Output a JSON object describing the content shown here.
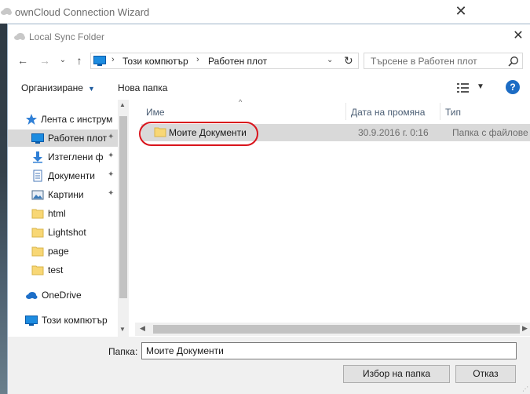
{
  "background_window": {
    "title": "ownCloud Connection Wizard",
    "close_glyph": "✕"
  },
  "dialog": {
    "title": "Local Sync Folder",
    "close_glyph": "✕"
  },
  "navigation": {
    "back_glyph": "←",
    "forward_glyph": "→",
    "recent_glyph": "⌄",
    "up_glyph": "↑",
    "address_crumbs": [
      "Този компютър",
      "Работен плот"
    ],
    "address_sep": "›",
    "dropdown_glyph": "⌄",
    "refresh_glyph": "↻",
    "search_placeholder": "Търсене в Работен плот"
  },
  "toolbar": {
    "organize_label": "Организиране",
    "organize_arrow": "▼",
    "new_folder_label": "Нова папка",
    "view_dropdown": "▼",
    "help_glyph": "?"
  },
  "nav_pane": {
    "items": [
      {
        "label": "Лента с инструм",
        "icon": "star-icon",
        "pinned": false,
        "selected": false
      },
      {
        "label": "Работен плот",
        "icon": "desktop-icon",
        "pinned": true,
        "selected": true
      },
      {
        "label": "Изтеглени ф",
        "icon": "download-icon",
        "pinned": true,
        "selected": false
      },
      {
        "label": "Документи",
        "icon": "documents-icon",
        "pinned": true,
        "selected": false
      },
      {
        "label": "Картини",
        "icon": "pictures-icon",
        "pinned": true,
        "selected": false
      },
      {
        "label": "html",
        "icon": "folder-icon",
        "pinned": false,
        "selected": false
      },
      {
        "label": "Lightshot",
        "icon": "folder-icon",
        "pinned": false,
        "selected": false
      },
      {
        "label": "page",
        "icon": "folder-icon",
        "pinned": false,
        "selected": false
      },
      {
        "label": "test",
        "icon": "folder-icon",
        "pinned": false,
        "selected": false
      },
      {
        "label": "OneDrive",
        "icon": "onedrive-icon",
        "pinned": false,
        "selected": false
      },
      {
        "label": "Този компютър",
        "icon": "computer-icon",
        "pinned": false,
        "selected": false
      }
    ],
    "pin_glyph": "📌",
    "expand_glyph": "›",
    "scroll_up_glyph": "▲",
    "scroll_down_glyph": "▼"
  },
  "file_list": {
    "columns": {
      "name": "Име",
      "date": "Дата на промяна",
      "type": "Тип"
    },
    "sort_glyph": "^",
    "rows": [
      {
        "name": "Моите Документи",
        "date": "30.9.2016 г. 0:16",
        "type": "Папка с файлове"
      }
    ],
    "scroll_left_glyph": "◀",
    "scroll_right_glyph": "▶"
  },
  "bottom": {
    "folder_label": "Папка:",
    "folder_value": "Моите Документи",
    "select_button": "Избор на папка",
    "cancel_button": "Отказ"
  },
  "colors": {
    "selection": "#d9d9d9",
    "highlight_ring": "#d9141c",
    "accent": "#1c6cc4",
    "folder": "#f8d775"
  }
}
